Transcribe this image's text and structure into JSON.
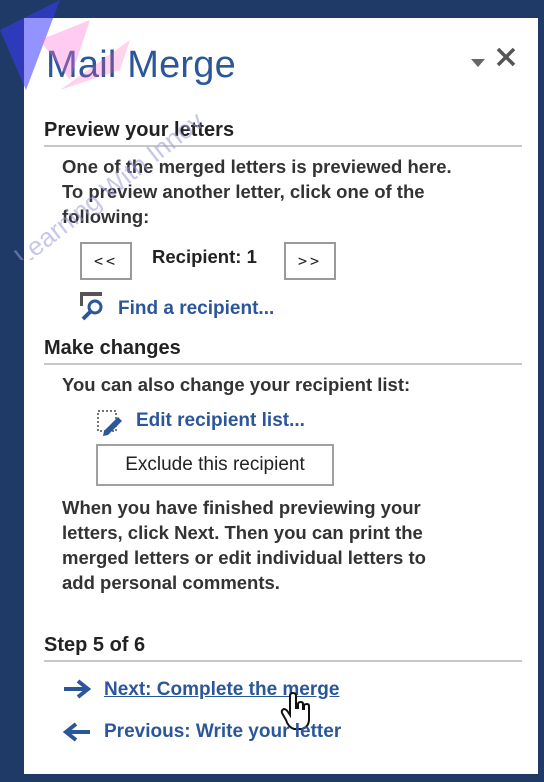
{
  "pane": {
    "title": "Mail Merge"
  },
  "preview": {
    "heading": "Preview your letters",
    "description_line1": "One of the merged letters is previewed here.",
    "description_line2": "To preview another letter, click one of the",
    "description_line3": "following:",
    "prev_label": "<<",
    "next_label": ">>",
    "recipient_label": "Recipient: 1",
    "find_link": "Find a recipient..."
  },
  "changes": {
    "heading": "Make changes",
    "description": "You can also change your recipient list:",
    "edit_link": "Edit recipient list...",
    "exclude_button": "Exclude this recipient",
    "finish_line1": "When you have finished previewing your",
    "finish_line2": "letters, click Next. Then you can print the",
    "finish_line3": "merged letters or edit individual letters to",
    "finish_line4": "add personal comments."
  },
  "step": {
    "heading": "Step 5 of 6",
    "next_link": "Next: Complete the merge",
    "previous_link": "Previous: Write your letter"
  },
  "colors": {
    "accent": "#2b579a",
    "frame": "#1f3a66",
    "watermark": "#3b3bff"
  }
}
